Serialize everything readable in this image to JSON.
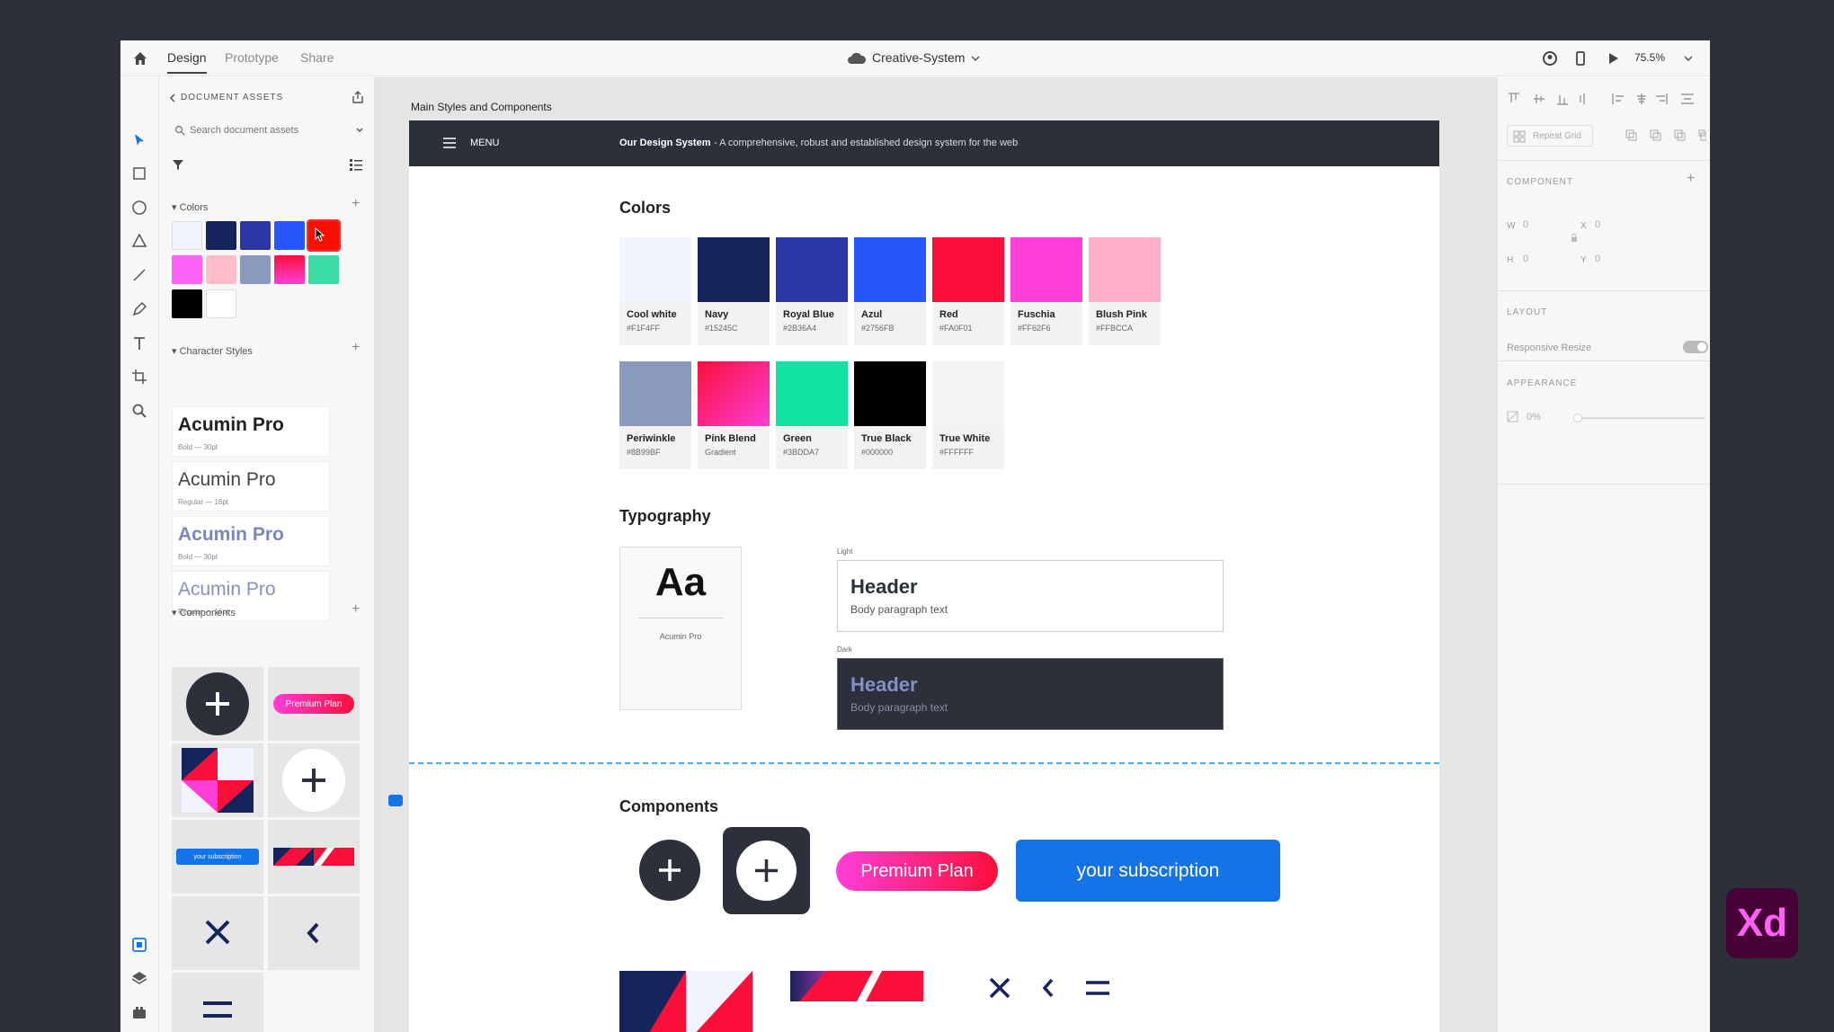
{
  "app": {
    "tabs": [
      "Design",
      "Prototype",
      "Share"
    ],
    "active_tab": "Design",
    "document_title": "Creative-System",
    "zoom": "75.5%"
  },
  "assets": {
    "header": "DOCUMENT ASSETS",
    "search_placeholder": "Search document assets",
    "colors_label": "Colors",
    "character_styles_label": "Character Styles",
    "components_label": "Components",
    "swatches": [
      "#F1F4FF",
      "#15245C",
      "#2B36A4",
      "#2756FB",
      "#FA0F01",
      "#FF62F6",
      "#FFBCCA",
      "#8B99BF",
      "gradient-pink-blend",
      "#3BDDA7",
      "#000000",
      "#FFFFFF"
    ],
    "character_styles": [
      {
        "name": "Acumin Pro",
        "desc": "Bold — 30pt",
        "color": "#222222",
        "weight": "bold"
      },
      {
        "name": "Acumin Pro",
        "desc": "Regular — 16pt",
        "color": "#444444",
        "weight": "normal"
      },
      {
        "name": "Acumin Pro",
        "desc": "Bold — 30pt",
        "color": "#7a86c0",
        "weight": "bold"
      },
      {
        "name": "Acumin Pro",
        "desc": "Regular — 16pt",
        "color": "#8390c4",
        "weight": "normal"
      }
    ],
    "component_labels": {
      "premium": "Premium Plan",
      "subscription": "your subscription"
    }
  },
  "canvas": {
    "artboard_label": "Main Styles and Components",
    "menu_label": "MENU",
    "header_title": "Our Design System",
    "header_desc": " - A comprehensive, robust and established design system for the web",
    "colors_heading": "Colors",
    "colors": [
      {
        "name": "Cool white",
        "hex": "#F1F4FF",
        "fill": "#F1F4FF"
      },
      {
        "name": "Navy",
        "hex": "#15245C",
        "fill": "#15245C"
      },
      {
        "name": "Royal Blue",
        "hex": "#2B36A4",
        "fill": "#2B36A4"
      },
      {
        "name": "Azul",
        "hex": "#2756FB",
        "fill": "#2756FB"
      },
      {
        "name": "Red",
        "hex": "#FA0F01",
        "fill": "#FA0F3A"
      },
      {
        "name": "Fuschia",
        "hex": "#FF62F6",
        "fill": "#FF3ED8"
      },
      {
        "name": "Blush Pink",
        "hex": "#FFBCCA",
        "fill": "#FFB0C8"
      },
      {
        "name": "Periwinkle",
        "hex": "#8B99BF",
        "fill": "#8B99BF"
      },
      {
        "name": "Pink Blend",
        "hex": "Gradient",
        "fill": "gradient"
      },
      {
        "name": "Green",
        "hex": "#3BDDA7",
        "fill": "#12E3A0"
      },
      {
        "name": "True Black",
        "hex": "#000000",
        "fill": "#000000"
      },
      {
        "name": "True White",
        "hex": "#FFFFFF",
        "fill": "#F4F4F4"
      }
    ],
    "typography_heading": "Typography",
    "type_specimen": "Aa",
    "type_font": "Acumin Pro",
    "light_label": "Light",
    "dark_label": "Dark",
    "type_header": "Header",
    "type_body": "Body paragraph text",
    "components_heading": "Components",
    "premium_label": "Premium Plan",
    "subscription_label": "your subscription"
  },
  "properties": {
    "repeat_grid": "Repeat Grid",
    "component": "COMPONENT",
    "w_label": "W",
    "w_value": "0",
    "x_label": "X",
    "x_value": "0",
    "h_label": "H",
    "h_value": "0",
    "y_label": "Y",
    "y_value": "0",
    "layout": "LAYOUT",
    "responsive_resize": "Responsive Resize",
    "appearance": "APPEARANCE",
    "opacity": "0%"
  },
  "logo_text": "Xd"
}
